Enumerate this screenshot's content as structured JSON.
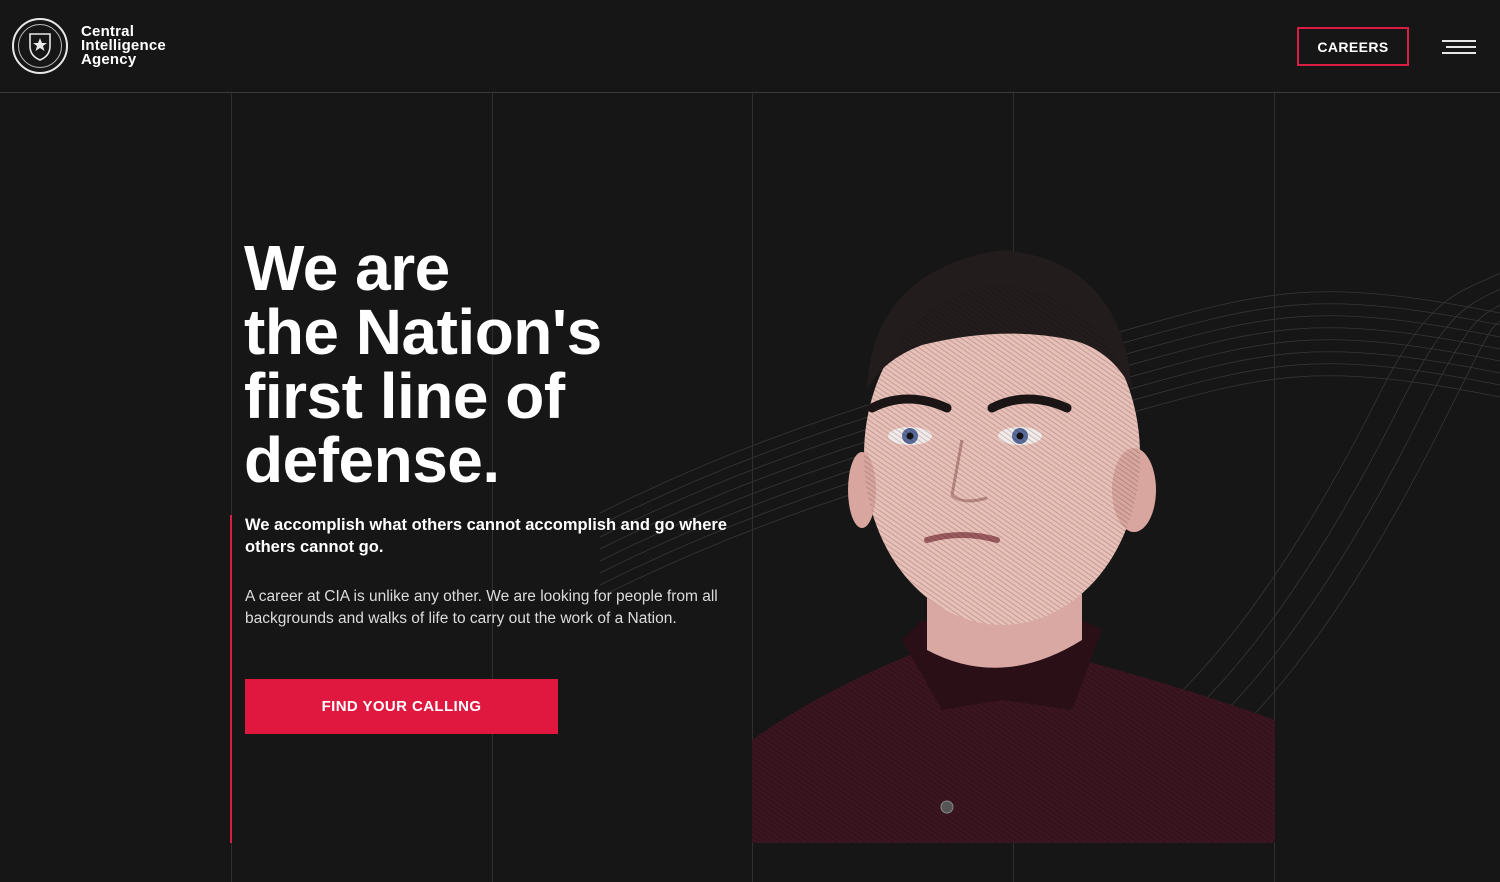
{
  "header": {
    "brand_lines": [
      "Central",
      "Intelligence",
      "Agency"
    ],
    "careers_label": "CAREERS",
    "menu_icon": "hamburger-menu-icon"
  },
  "hero": {
    "headline_lines": [
      "We are",
      "the Nation's",
      "first line of",
      "defense."
    ],
    "subhead": "We accomplish what others cannot accomplish and go where others cannot go.",
    "body": "A career at CIA is unlike any other. We are looking for people from all backgrounds and walks of life to carry out the work of a Nation.",
    "cta_label": "FIND YOUR CALLING"
  },
  "colors": {
    "background": "#161616",
    "accent": "#e0173f",
    "text": "#ffffff",
    "grid_line": "#2f2f2f"
  }
}
